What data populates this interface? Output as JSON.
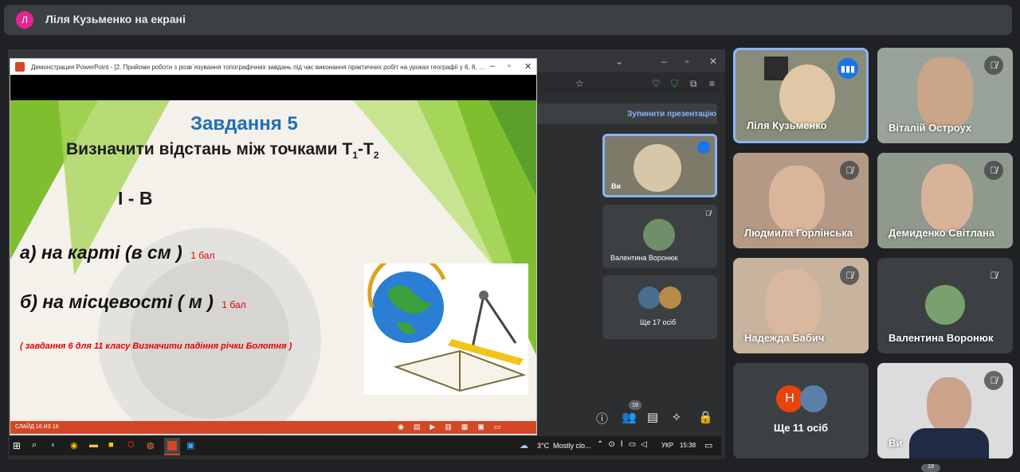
{
  "meet": {
    "avatar_letter": "Л",
    "presenting_title": "Ліля Кузьменко на екрані",
    "stop_presenting": "Зупинити презентацію",
    "participant_count": "19",
    "bottom_badge": "19",
    "accent_blue": "#1a73e8"
  },
  "self_tile": {
    "label": "Ви"
  },
  "side_tiles": {
    "valentina_name": "Валентина Воронюк",
    "more_label": "Ще 17 осіб"
  },
  "ppt": {
    "window_title": "Демонстрация PowerPoint - [2. Прийоми роботи з розв`язування топографічних завдань  під час виконання практичних робіт  на уроках географії у 6, 8, 11-...",
    "status_slide": "СЛАЙД 16 ИЗ 18",
    "slide": {
      "title": "Завдання 5",
      "subtitle": "Визначити відстань між точками Т",
      "sub1": "1",
      "dash": "-Т",
      "sub2": "2",
      "variant": "І - В",
      "item_a": "а) на карті (в см )",
      "item_a_points": "1 бал",
      "item_b": "б) на місцевості ( м )",
      "item_b_points": "1 бал",
      "note": "( завдання 6 для 11 класу  Визначити падіння річки Болотня )"
    }
  },
  "taskbar": {
    "weather": "3°C",
    "weather_text": "Mostly clo...",
    "lang": "УКР",
    "time": "15:38"
  },
  "participants": [
    {
      "name": "Ліля Кузьменко",
      "muted": false,
      "speaking": true
    },
    {
      "name": "Віталій Остроух",
      "muted": true
    },
    {
      "name": "Людмила Горлінська",
      "muted": true
    },
    {
      "name": "Демиденко Світлана",
      "muted": true
    },
    {
      "name": "Надежда Бабич",
      "muted": true
    },
    {
      "name": "Валентина Воронюк",
      "muted": true
    },
    {
      "name": "Ще 11 осіб",
      "avatar_letter": "Н"
    },
    {
      "name": "Ви",
      "muted": true
    }
  ]
}
